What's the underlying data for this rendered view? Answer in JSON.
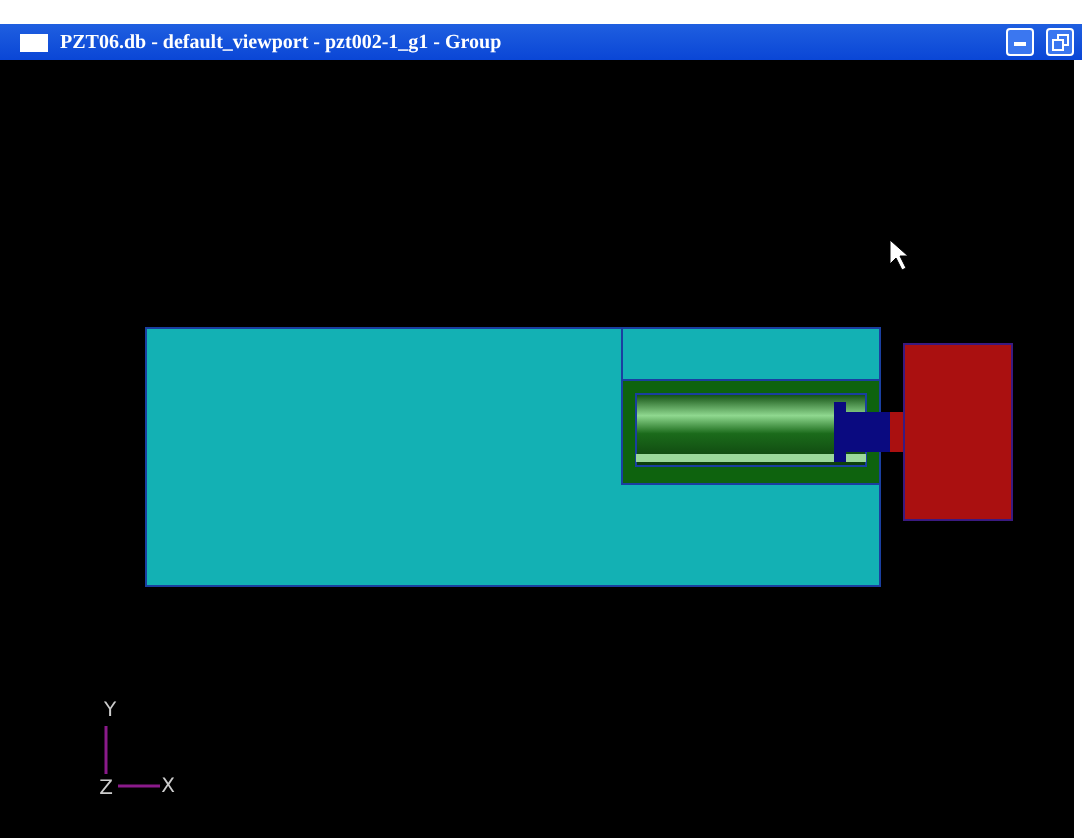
{
  "window": {
    "title": "PZT06.db - default_viewport - pzt002-1_g1 - Group"
  },
  "axes": [
    {
      "label": "Y",
      "kind": "vertical"
    },
    {
      "label": "Z",
      "kind": "origin"
    },
    {
      "label": "X",
      "kind": "horizontal"
    }
  ]
}
